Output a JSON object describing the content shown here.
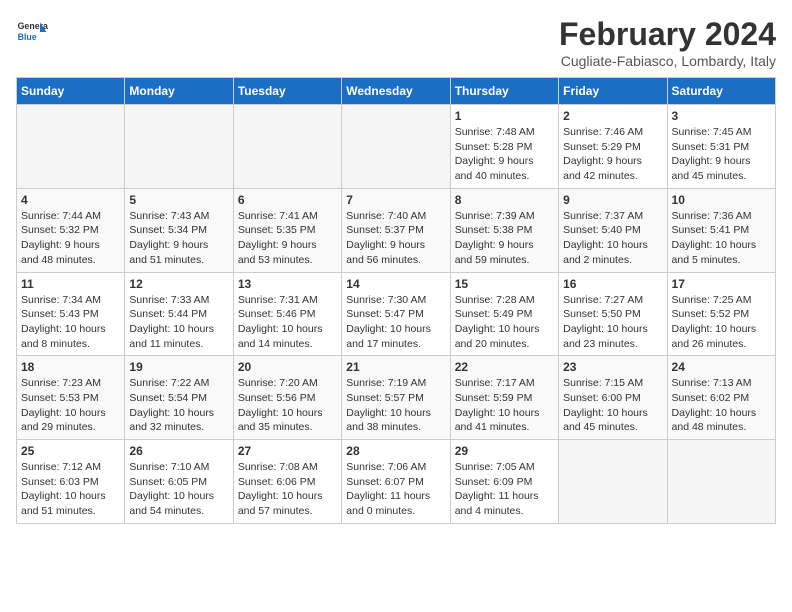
{
  "logo": {
    "line1": "General",
    "line2": "Blue"
  },
  "title": "February 2024",
  "subtitle": "Cugliate-Fabiasco, Lombardy, Italy",
  "weekdays": [
    "Sunday",
    "Monday",
    "Tuesday",
    "Wednesday",
    "Thursday",
    "Friday",
    "Saturday"
  ],
  "weeks": [
    [
      {
        "day": "",
        "info": ""
      },
      {
        "day": "",
        "info": ""
      },
      {
        "day": "",
        "info": ""
      },
      {
        "day": "",
        "info": ""
      },
      {
        "day": "1",
        "info": "Sunrise: 7:48 AM\nSunset: 5:28 PM\nDaylight: 9 hours\nand 40 minutes."
      },
      {
        "day": "2",
        "info": "Sunrise: 7:46 AM\nSunset: 5:29 PM\nDaylight: 9 hours\nand 42 minutes."
      },
      {
        "day": "3",
        "info": "Sunrise: 7:45 AM\nSunset: 5:31 PM\nDaylight: 9 hours\nand 45 minutes."
      }
    ],
    [
      {
        "day": "4",
        "info": "Sunrise: 7:44 AM\nSunset: 5:32 PM\nDaylight: 9 hours\nand 48 minutes."
      },
      {
        "day": "5",
        "info": "Sunrise: 7:43 AM\nSunset: 5:34 PM\nDaylight: 9 hours\nand 51 minutes."
      },
      {
        "day": "6",
        "info": "Sunrise: 7:41 AM\nSunset: 5:35 PM\nDaylight: 9 hours\nand 53 minutes."
      },
      {
        "day": "7",
        "info": "Sunrise: 7:40 AM\nSunset: 5:37 PM\nDaylight: 9 hours\nand 56 minutes."
      },
      {
        "day": "8",
        "info": "Sunrise: 7:39 AM\nSunset: 5:38 PM\nDaylight: 9 hours\nand 59 minutes."
      },
      {
        "day": "9",
        "info": "Sunrise: 7:37 AM\nSunset: 5:40 PM\nDaylight: 10 hours\nand 2 minutes."
      },
      {
        "day": "10",
        "info": "Sunrise: 7:36 AM\nSunset: 5:41 PM\nDaylight: 10 hours\nand 5 minutes."
      }
    ],
    [
      {
        "day": "11",
        "info": "Sunrise: 7:34 AM\nSunset: 5:43 PM\nDaylight: 10 hours\nand 8 minutes."
      },
      {
        "day": "12",
        "info": "Sunrise: 7:33 AM\nSunset: 5:44 PM\nDaylight: 10 hours\nand 11 minutes."
      },
      {
        "day": "13",
        "info": "Sunrise: 7:31 AM\nSunset: 5:46 PM\nDaylight: 10 hours\nand 14 minutes."
      },
      {
        "day": "14",
        "info": "Sunrise: 7:30 AM\nSunset: 5:47 PM\nDaylight: 10 hours\nand 17 minutes."
      },
      {
        "day": "15",
        "info": "Sunrise: 7:28 AM\nSunset: 5:49 PM\nDaylight: 10 hours\nand 20 minutes."
      },
      {
        "day": "16",
        "info": "Sunrise: 7:27 AM\nSunset: 5:50 PM\nDaylight: 10 hours\nand 23 minutes."
      },
      {
        "day": "17",
        "info": "Sunrise: 7:25 AM\nSunset: 5:52 PM\nDaylight: 10 hours\nand 26 minutes."
      }
    ],
    [
      {
        "day": "18",
        "info": "Sunrise: 7:23 AM\nSunset: 5:53 PM\nDaylight: 10 hours\nand 29 minutes."
      },
      {
        "day": "19",
        "info": "Sunrise: 7:22 AM\nSunset: 5:54 PM\nDaylight: 10 hours\nand 32 minutes."
      },
      {
        "day": "20",
        "info": "Sunrise: 7:20 AM\nSunset: 5:56 PM\nDaylight: 10 hours\nand 35 minutes."
      },
      {
        "day": "21",
        "info": "Sunrise: 7:19 AM\nSunset: 5:57 PM\nDaylight: 10 hours\nand 38 minutes."
      },
      {
        "day": "22",
        "info": "Sunrise: 7:17 AM\nSunset: 5:59 PM\nDaylight: 10 hours\nand 41 minutes."
      },
      {
        "day": "23",
        "info": "Sunrise: 7:15 AM\nSunset: 6:00 PM\nDaylight: 10 hours\nand 45 minutes."
      },
      {
        "day": "24",
        "info": "Sunrise: 7:13 AM\nSunset: 6:02 PM\nDaylight: 10 hours\nand 48 minutes."
      }
    ],
    [
      {
        "day": "25",
        "info": "Sunrise: 7:12 AM\nSunset: 6:03 PM\nDaylight: 10 hours\nand 51 minutes."
      },
      {
        "day": "26",
        "info": "Sunrise: 7:10 AM\nSunset: 6:05 PM\nDaylight: 10 hours\nand 54 minutes."
      },
      {
        "day": "27",
        "info": "Sunrise: 7:08 AM\nSunset: 6:06 PM\nDaylight: 10 hours\nand 57 minutes."
      },
      {
        "day": "28",
        "info": "Sunrise: 7:06 AM\nSunset: 6:07 PM\nDaylight: 11 hours\nand 0 minutes."
      },
      {
        "day": "29",
        "info": "Sunrise: 7:05 AM\nSunset: 6:09 PM\nDaylight: 11 hours\nand 4 minutes."
      },
      {
        "day": "",
        "info": ""
      },
      {
        "day": "",
        "info": ""
      }
    ]
  ]
}
